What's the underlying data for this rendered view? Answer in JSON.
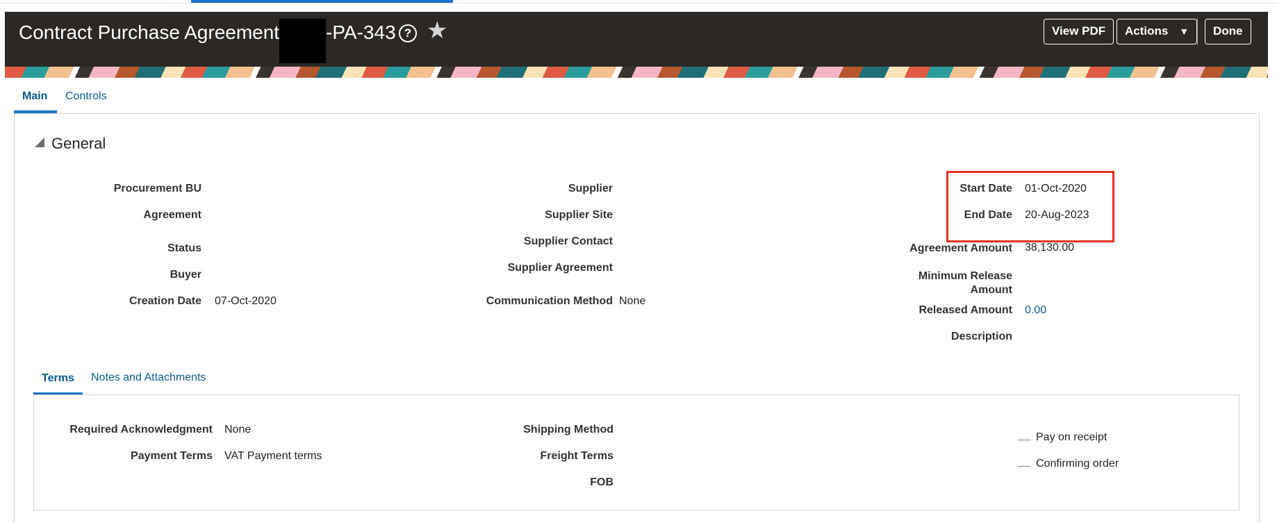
{
  "header": {
    "title_prefix": "Contract Purchase Agreement:",
    "title_suffix": "-PA-343",
    "help_glyph": "?",
    "star_glyph": "★",
    "buttons": {
      "view_pdf": "View PDF",
      "actions": "Actions",
      "actions_caret": "▼",
      "done": "Done"
    }
  },
  "tabs": [
    {
      "label": "Main",
      "active": true
    },
    {
      "label": "Controls",
      "active": false
    }
  ],
  "general": {
    "section_title": "General",
    "col1": {
      "procurement_bu": {
        "label": "Procurement BU",
        "value": ""
      },
      "agreement": {
        "label": "Agreement",
        "value": ""
      },
      "status": {
        "label": "Status",
        "value": ""
      },
      "buyer": {
        "label": "Buyer",
        "value": ""
      },
      "creation_date": {
        "label": "Creation Date",
        "value": "07-Oct-2020"
      }
    },
    "col2": {
      "supplier": {
        "label": "Supplier",
        "value": ""
      },
      "supplier_site": {
        "label": "Supplier Site",
        "value": ""
      },
      "supplier_contact": {
        "label": "Supplier Contact",
        "value": ""
      },
      "supplier_agreement": {
        "label": "Supplier Agreement",
        "value": ""
      },
      "communication_method": {
        "label": "Communication Method",
        "value": "None"
      }
    },
    "col3": {
      "start_date": {
        "label": "Start Date",
        "value": "01-Oct-2020"
      },
      "end_date": {
        "label": "End Date",
        "value": "20-Aug-2023"
      },
      "agreement_amount": {
        "label": "Agreement Amount",
        "value": "38,130.00"
      },
      "minimum_release_amount": {
        "label_line1": "Minimum Release",
        "label_line2": "Amount",
        "value": ""
      },
      "released_amount": {
        "label": "Released Amount",
        "value": "0.00"
      },
      "description": {
        "label": "Description",
        "value": ""
      }
    }
  },
  "subtabs": [
    {
      "label": "Terms",
      "active": true
    },
    {
      "label": "Notes and Attachments",
      "active": false
    }
  ],
  "terms": {
    "required_acknowledgment": {
      "label": "Required Acknowledgment",
      "value": "None"
    },
    "payment_terms": {
      "label": "Payment Terms",
      "value": "VAT Payment terms"
    },
    "shipping_method": {
      "label": "Shipping Method",
      "value": ""
    },
    "freight_terms": {
      "label": "Freight Terms",
      "value": ""
    },
    "fob": {
      "label": "FOB",
      "value": ""
    },
    "checkboxes": [
      {
        "label": "Pay on receipt"
      },
      {
        "label": "Confirming order"
      }
    ]
  },
  "colors": {
    "header_bg": "#2b2825",
    "link": "#0b5b8f",
    "accent": "#1a73c7",
    "highlight": "#e53222"
  },
  "icons": {
    "help": "help-icon",
    "star": "favorite-star-icon",
    "collapse": "collapse-triangle-icon",
    "dropdown": "chevron-down-icon"
  }
}
